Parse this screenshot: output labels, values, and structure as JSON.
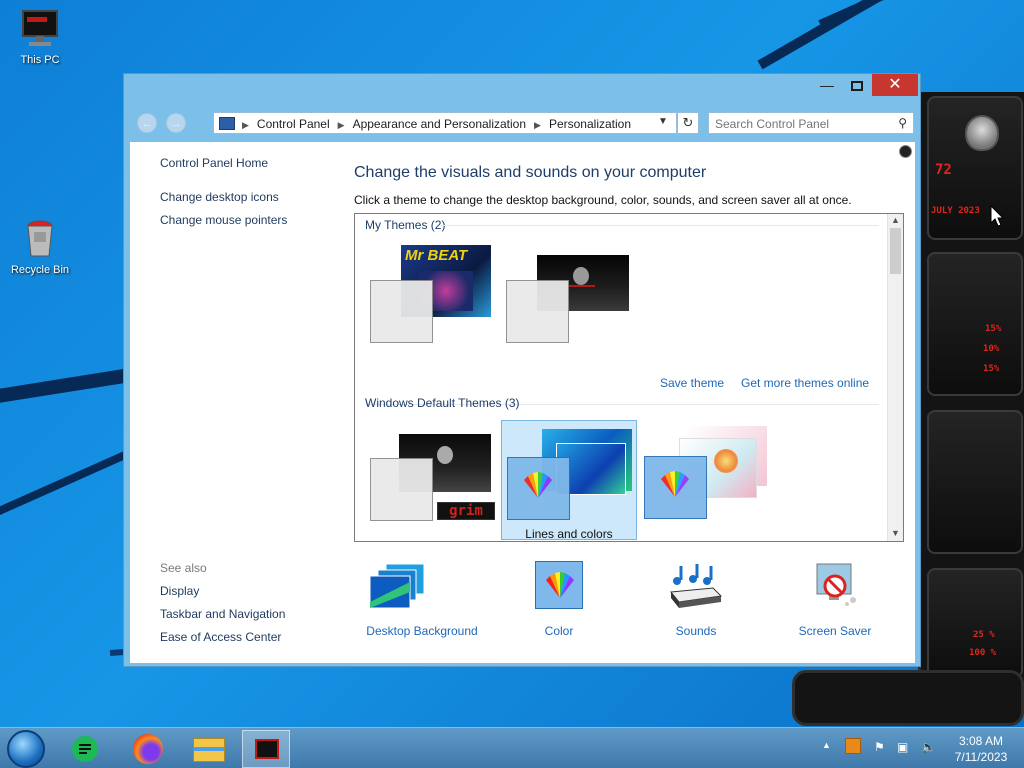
{
  "desktop": {
    "icons": [
      {
        "label": "This PC"
      },
      {
        "label": "Recycle Bin"
      }
    ],
    "gadget": {
      "lines": [
        "72",
        "JULY 2023",
        "15%",
        "10%",
        "15%",
        "25 %",
        "100 %"
      ]
    }
  },
  "window": {
    "address": {
      "segments": [
        "Control Panel",
        "Appearance and Personalization",
        "Personalization"
      ]
    },
    "search": {
      "placeholder": "Search Control Panel"
    },
    "left_nav": {
      "items": [
        "Control Panel Home",
        "Change desktop icons",
        "Change mouse pointers"
      ]
    },
    "see_also": {
      "header": "See also",
      "items": [
        "Display",
        "Taskbar and Navigation",
        "Ease of Access Center"
      ]
    },
    "main": {
      "title": "Change the visuals and sounds on your computer",
      "description": "Click a theme to change the desktop background, color, sounds, and screen saver all at once."
    },
    "themes": {
      "my_themes_header": "My Themes (2)",
      "default_header": "Windows Default Themes (3)",
      "save_theme": "Save theme",
      "get_more": "Get more themes online",
      "my_themes": [
        {
          "name": "",
          "thumb_text": "Mr BEAT"
        },
        {
          "name": ""
        }
      ],
      "default_themes": [
        {
          "name": "",
          "thumb_text": "grim"
        },
        {
          "name": "Lines and colors",
          "selected": true
        },
        {
          "name": ""
        }
      ]
    },
    "options": [
      {
        "label": "Desktop Background",
        "icon": "desktop-background-icon"
      },
      {
        "label": "Color",
        "icon": "color-icon"
      },
      {
        "label": "Sounds",
        "icon": "sounds-icon"
      },
      {
        "label": "Screen Saver",
        "icon": "screen-saver-icon"
      }
    ]
  },
  "taskbar": {
    "time": "3:08 AM",
    "date": "7/11/2023"
  },
  "colors": {
    "accent": "#1e68b8",
    "title": "#1e3e69",
    "close": "#c7372f",
    "selected_theme": "#cde8fb"
  }
}
